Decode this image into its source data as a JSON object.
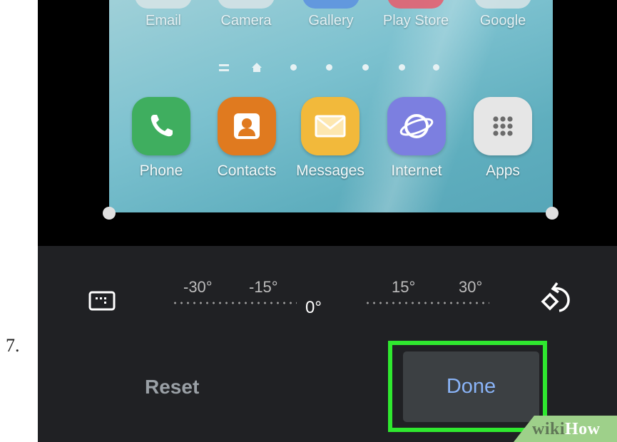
{
  "step": {
    "number": "7."
  },
  "home_screen": {
    "top_row_labels": [
      "Email",
      "Camera",
      "Gallery",
      "Play Store",
      "Google"
    ],
    "apps": [
      {
        "label": "Phone",
        "icon": "phone-icon",
        "color": "#3fae5f"
      },
      {
        "label": "Contacts",
        "icon": "contact-icon",
        "color": "#e07a1f"
      },
      {
        "label": "Messages",
        "icon": "envelope-icon",
        "color": "#f2b93b"
      },
      {
        "label": "Internet",
        "icon": "planet-icon",
        "color": "#7c7fe0"
      },
      {
        "label": "Apps",
        "icon": "grid-icon",
        "color": "#e6e6e6"
      }
    ]
  },
  "editor": {
    "aspect_icon": "aspect-ratio-icon",
    "ruler_labels": [
      "-30°",
      "-15°",
      "15°",
      "30°"
    ],
    "angle": "0°",
    "rotate_icon": "rotate-icon",
    "reset_label": "Reset",
    "done_label": "Done",
    "highlight_color": "#2fe82f",
    "accent_color": "#8ab4f8"
  },
  "watermark": {
    "wiki": "wiki",
    "how": "How"
  }
}
